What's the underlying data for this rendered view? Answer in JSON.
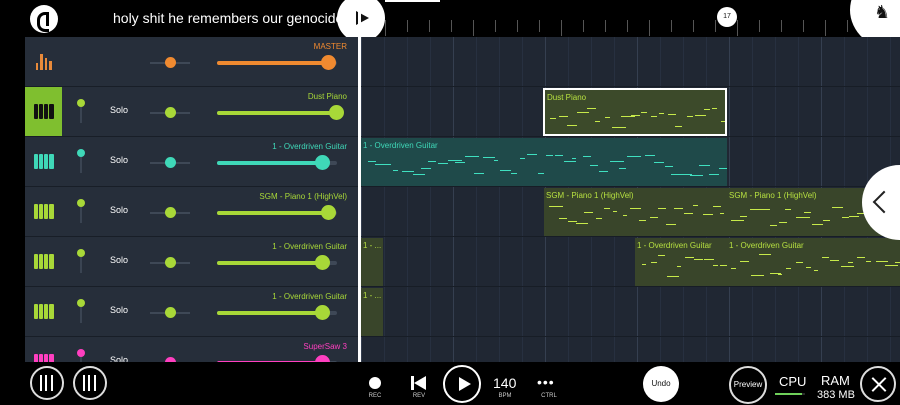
{
  "header": {
    "song_title": "holy shit he remembers our genocides",
    "marker_label": "17"
  },
  "colors": {
    "accent_green": "#7fbf2f",
    "master_orange": "#f08a30",
    "teal": "#3fd8b8",
    "lime": "#a8d838",
    "magenta": "#ff3fc0"
  },
  "channels": [
    {
      "name": "MASTER",
      "icon": "master-bars-icon",
      "color": "#f08a30",
      "solo": "",
      "volume": 0.93,
      "active": false
    },
    {
      "name": "Dust Piano",
      "icon": "piano-keys-icon",
      "color": "#a8d838",
      "solo": "Solo",
      "volume": 1.0,
      "active": true
    },
    {
      "name": "1 - Overdriven Guitar",
      "icon": "piano-keys-icon",
      "color": "#3fd8b8",
      "solo": "Solo",
      "volume": 0.88,
      "active": false
    },
    {
      "name": "SGM - Piano 1 (HighVel)",
      "icon": "piano-keys-icon",
      "color": "#a8d838",
      "solo": "Solo",
      "volume": 0.93,
      "active": false
    },
    {
      "name": "1 - Overdriven Guitar",
      "icon": "piano-keys-icon",
      "color": "#a8d838",
      "solo": "Solo",
      "volume": 0.88,
      "active": false
    },
    {
      "name": "1 - Overdriven Guitar",
      "icon": "piano-keys-icon",
      "color": "#a8d838",
      "solo": "Solo",
      "volume": 0.88,
      "active": false
    },
    {
      "name": "SuperSaw 3",
      "icon": "piano-keys-icon",
      "color": "#ff3fc0",
      "solo": "Solo",
      "volume": 0.88,
      "active": false
    }
  ],
  "clips": [
    {
      "label": "Dust Piano",
      "lane": 1,
      "start": 182,
      "width": 184,
      "style": "piano",
      "selected": true
    },
    {
      "label": "1 - Overdriven Guitar",
      "lane": 2,
      "start": 0,
      "width": 366,
      "style": "guitar",
      "selected": false
    },
    {
      "label": "SGM - Piano 1 (HighVel)",
      "lane": 3,
      "start": 183,
      "width": 183,
      "style": "sgm",
      "selected": false
    },
    {
      "label": "SGM - Piano 1 (HighVel)",
      "lane": 3,
      "start": 366,
      "width": 173,
      "style": "sgm",
      "selected": false
    },
    {
      "label": "1 - ...",
      "lane": 4,
      "start": 0,
      "width": 22,
      "style": "sgm",
      "selected": false
    },
    {
      "label": "1 - Overdriven Guitar",
      "lane": 4,
      "start": 274,
      "width": 92,
      "style": "sgm",
      "selected": false
    },
    {
      "label": "1 - Overdriven Guitar",
      "lane": 4,
      "start": 366,
      "width": 173,
      "style": "sgm",
      "selected": false
    },
    {
      "label": "1 - ...",
      "lane": 5,
      "start": 0,
      "width": 22,
      "style": "sgm",
      "selected": false
    }
  ],
  "transport": {
    "rec_label": "REC",
    "rev_label": "REV",
    "bpm_value": "140",
    "bpm_label": "BPM",
    "ctrl_symbol": "•••",
    "ctrl_label": "CTRL",
    "undo_label": "Undo",
    "preview_label": "Preview",
    "cpu_label": "CPU",
    "cpu_level": 0.9,
    "ram_label": "RAM",
    "ram_value": "383 MB"
  },
  "icons": {
    "logo": "fl-logo-icon",
    "play": "play-icon",
    "plugin": "plugin-bird-icon",
    "expand": "chevron-left-icon",
    "mixer": "mixer-icon",
    "browser": "browser-icon",
    "close": "close-icon"
  }
}
